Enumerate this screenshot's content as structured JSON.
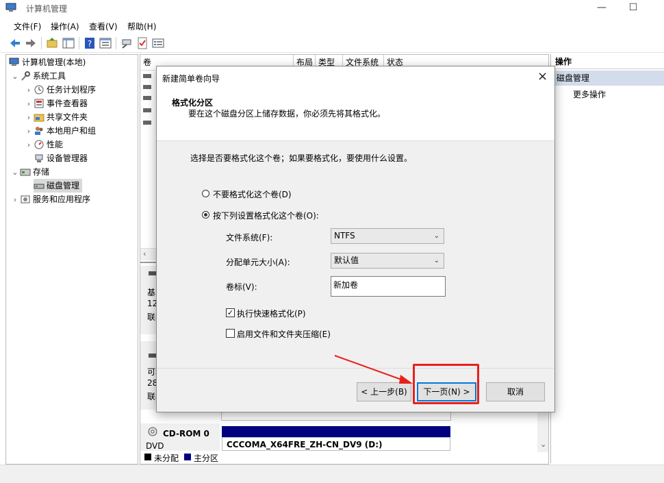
{
  "window": {
    "title": "计算机管理"
  },
  "menu": [
    "文件(F)",
    "操作(A)",
    "查看(V)",
    "帮助(H)"
  ],
  "tree": {
    "root": "计算机管理(本地)",
    "system_tools": "系统工具",
    "children": [
      "任务计划程序",
      "事件查看器",
      "共享文件夹",
      "本地用户和组",
      "性能",
      "设备管理器"
    ],
    "storage": "存储",
    "disk_mgmt": "磁盘管理",
    "services": "服务和应用程序"
  },
  "center": {
    "columns": [
      "卷",
      "布局",
      "类型",
      "文件系统",
      "状态"
    ],
    "disk_rows": [
      {
        "l1": "基本",
        "l2": "12",
        "l3": "联机"
      },
      {
        "l1": "可移",
        "l2": "28",
        "l3": "联机"
      }
    ],
    "cdrom": {
      "name": "CD-ROM 0",
      "type": "DVD",
      "volume": "CCCOMA_X64FRE_ZH-CN_DV9  (D:)"
    },
    "legend": [
      "未分配",
      "主分区"
    ]
  },
  "actions": {
    "header": "操作",
    "section": "磁盘管理",
    "more": "更多操作"
  },
  "dialog": {
    "title": "新建简单卷向导",
    "heading": "格式化分区",
    "subheading": "要在这个磁盘分区上储存数据，你必须先将其格式化。",
    "prompt": "选择是否要格式化这个卷；如果要格式化，要使用什么设置。",
    "radio_no_format": "不要格式化这个卷(D)",
    "radio_format": "按下列设置格式化这个卷(O):",
    "fs_label": "文件系统(F):",
    "fs_value": "NTFS",
    "alloc_label": "分配单元大小(A):",
    "alloc_value": "默认值",
    "vol_label": "卷标(V):",
    "vol_value": "新加卷",
    "quick_format": "执行快速格式化(P)",
    "compress": "启用文件和文件夹压缩(E)",
    "back": "< 上一步(B)",
    "next": "下一页(N) >",
    "cancel": "取消"
  },
  "colors": {
    "accent": "#0078d7",
    "highlight": "#e8201b",
    "partition": "#000080"
  }
}
